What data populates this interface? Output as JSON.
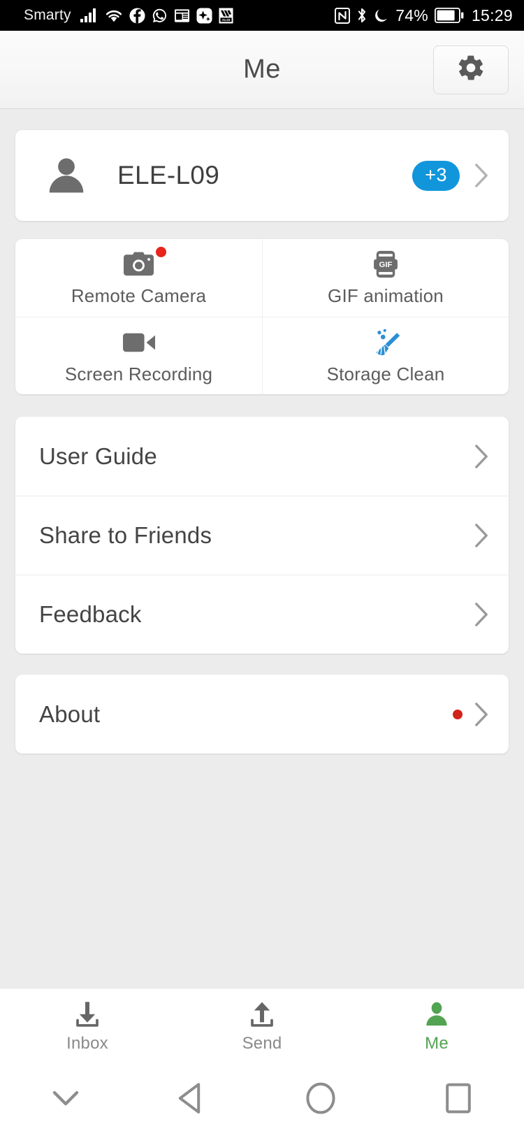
{
  "status_bar": {
    "carrier": "Smarty",
    "battery_percent": "74%",
    "time": "15:29",
    "icons": [
      "signal-bars-icon",
      "wifi-icon",
      "facebook-icon",
      "whatsapp-icon",
      "news-app-icon",
      "sparkle-app-icon",
      "aldi-app-icon",
      "nfc-icon",
      "bluetooth-icon",
      "do-not-disturb-moon-icon",
      "battery-icon"
    ]
  },
  "header": {
    "title": "Me",
    "settings_icon": "gear-icon"
  },
  "profile": {
    "avatar_icon": "person-icon",
    "device_name": "ELE-L09",
    "badge": "+3",
    "chevron_icon": "chevron-right-icon"
  },
  "features": [
    {
      "label": "Remote Camera",
      "icon": "camera-icon",
      "badge_dot": true
    },
    {
      "label": "GIF animation",
      "icon": "gif-icon",
      "badge_dot": false
    },
    {
      "label": "Screen Recording",
      "icon": "video-camera-icon",
      "badge_dot": false
    },
    {
      "label": "Storage Clean",
      "icon": "broom-icon",
      "badge_dot": false
    }
  ],
  "menu": [
    {
      "label": "User Guide",
      "chevron_icon": "chevron-right-icon",
      "badge_dot": false
    },
    {
      "label": "Share to Friends",
      "chevron_icon": "chevron-right-icon",
      "badge_dot": false
    },
    {
      "label": "Feedback",
      "chevron_icon": "chevron-right-icon",
      "badge_dot": false
    }
  ],
  "about": {
    "label": "About",
    "chevron_icon": "chevron-right-icon",
    "badge_dot": true
  },
  "tabs": [
    {
      "label": "Inbox",
      "icon": "download-inbox-icon",
      "active": false
    },
    {
      "label": "Send",
      "icon": "upload-send-icon",
      "active": false
    },
    {
      "label": "Me",
      "icon": "person-icon",
      "active": true
    }
  ],
  "nav_bar": {
    "buttons": [
      "chevron-down-icon",
      "back-triangle-icon",
      "home-circle-icon",
      "recents-square-icon"
    ]
  },
  "colors": {
    "accent_blue": "#1296db",
    "badge_red": "#e8241c",
    "active_green": "#52a352",
    "background": "#ececec",
    "card": "#ffffff"
  }
}
